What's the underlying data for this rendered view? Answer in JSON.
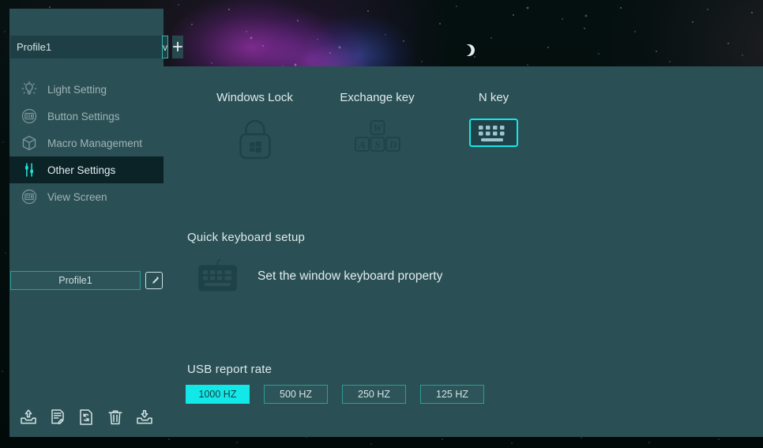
{
  "theme": {
    "panel_bg": "#2a5055",
    "accent_cyan": "#13e8e8",
    "border_teal": "#2d9e95",
    "active_nav_bg": "#0b2327",
    "text_primary": "#e2ecee",
    "text_muted": "#9fb3b6"
  },
  "background": {
    "scene": "space-nebula-stars",
    "moon_icon": "crescent-moon-icon"
  },
  "sidebar": {
    "profile_select": {
      "value": "Profile1",
      "placeholder": "Profile1",
      "dropdown_glyph": "v",
      "dropdown_icon": "chevron-down-icon",
      "add_glyph": "+",
      "add_icon": "plus-icon"
    },
    "items": [
      {
        "label": "Light Setting",
        "icon": "lightbulb-icon",
        "active": false
      },
      {
        "label": "Button Settings",
        "icon": "keypad-circle-icon",
        "active": false
      },
      {
        "label": "Macro Management",
        "icon": "cube-box-icon",
        "active": false
      },
      {
        "label": "Other Settings",
        "icon": "sliders-icon",
        "active": true
      },
      {
        "label": "View Screen",
        "icon": "keypad-circle-icon",
        "active": false
      }
    ],
    "profile_name": {
      "label": "Profile1",
      "edit_icon": "edit-pencil-square-icon"
    },
    "toolbar": [
      {
        "icon": "export-tray-up-icon"
      },
      {
        "icon": "document-edit-icon"
      },
      {
        "icon": "document-sync-icon"
      },
      {
        "icon": "trash-delete-icon"
      },
      {
        "icon": "import-tray-down-icon"
      }
    ]
  },
  "main": {
    "toggles": [
      {
        "label": "Windows Lock",
        "icon": "padlock-windows-icon",
        "enabled": false
      },
      {
        "label": "Exchange key",
        "icon": "wasd-keys-icon",
        "enabled": false
      },
      {
        "label": "N key",
        "icon": "keyboard-icon",
        "enabled": true
      }
    ],
    "quick_setup": {
      "title": "Quick keyboard setup",
      "action_label": "Set the window keyboard property",
      "icon": "keyboard-filled-icon"
    },
    "usb_report_rate": {
      "title": "USB report rate",
      "options": [
        {
          "label": "1000 HZ",
          "selected": true
        },
        {
          "label": "500 HZ",
          "selected": false
        },
        {
          "label": "250 HZ",
          "selected": false
        },
        {
          "label": "125 HZ",
          "selected": false
        }
      ]
    }
  }
}
